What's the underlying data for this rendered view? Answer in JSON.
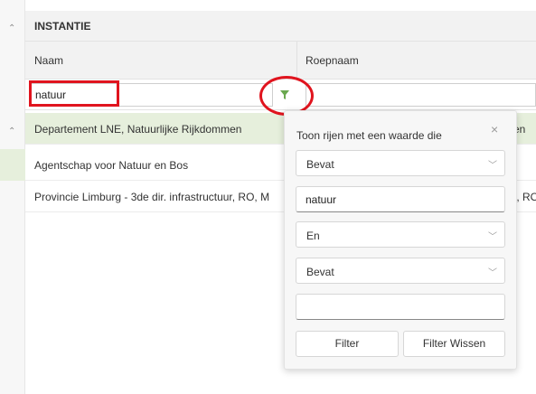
{
  "group": {
    "title": "INSTANTIE"
  },
  "columns": {
    "naam": "Naam",
    "roepnaam": "Roepnaam"
  },
  "filter_row": {
    "naam_value": "natuur"
  },
  "rows": [
    {
      "naam": "Departement LNE,  Natuurlijke Rijkdommen",
      "roepnaam": "en"
    },
    {
      "naam": "Agentschap voor Natuur en Bos",
      "roepnaam": ""
    },
    {
      "naam": "Provincie Limburg - 3de dir. infrastructuur, RO, M",
      "roepnaam": "r, RO"
    }
  ],
  "popup": {
    "title": "Toon rijen met een waarde die",
    "close_glyph": "×",
    "operator1": "Bevat",
    "value1": "natuur",
    "join": "En",
    "operator2": "Bevat",
    "value2": "",
    "filter_button": "Filter",
    "clear_button": "Filter Wissen"
  },
  "colors": {
    "accent_green": "#6aa84f",
    "selected_row": "#e6efdc",
    "annotation_red": "#e0141e"
  },
  "icons": {
    "filter": "funnel-icon",
    "collapse": "chevron-up-icon",
    "dropdown": "chevron-down-icon"
  }
}
